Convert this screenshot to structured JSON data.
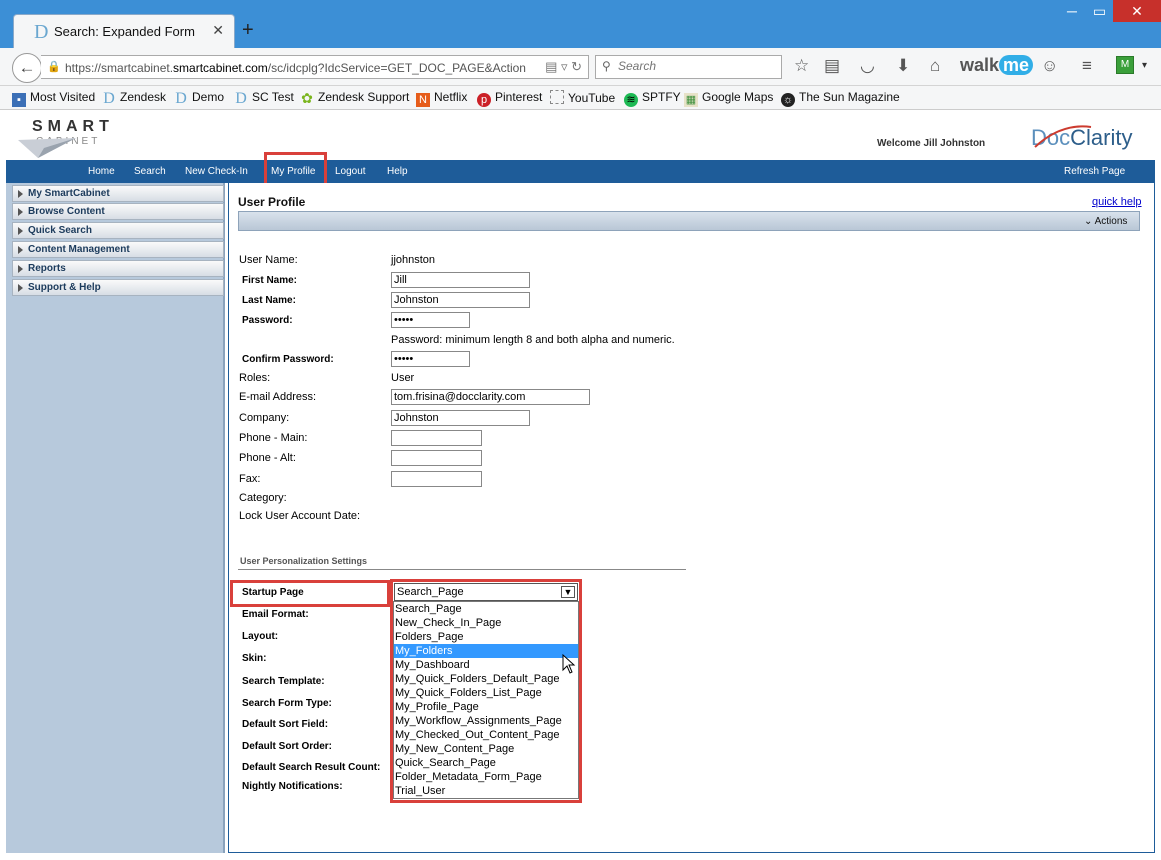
{
  "browser": {
    "tab_title": "Search: Expanded Form",
    "tab_favicon": "D",
    "url_host_prefix": "https://smartcabinet.",
    "url_host": "smartcabinet.com",
    "url_path": "/sc/idcplg?IdcService=GET_DOC_PAGE&Action",
    "search_placeholder": "Search",
    "walkme_a": "walk",
    "walkme_b": "me"
  },
  "bookmarks": [
    {
      "label": "Most Visited",
      "icon": "bookmark-folder-icon"
    },
    {
      "label": "Zendesk",
      "icon": "docclarity-d-icon"
    },
    {
      "label": "Demo",
      "icon": "docclarity-d-icon"
    },
    {
      "label": "SC Test",
      "icon": "docclarity-d-icon"
    },
    {
      "label": "Zendesk Support",
      "icon": "zendesk-icon"
    },
    {
      "label": "Netflix",
      "icon": "netflix-icon"
    },
    {
      "label": "Pinterest",
      "icon": "pinterest-icon"
    },
    {
      "label": "YouTube",
      "icon": "youtube-icon"
    },
    {
      "label": "SPTFY",
      "icon": "spotify-icon"
    },
    {
      "label": "Google Maps",
      "icon": "maps-icon"
    },
    {
      "label": "The Sun Magazine",
      "icon": "sun-icon"
    }
  ],
  "header": {
    "logo_line1": "SMART",
    "logo_line2": "CABINET",
    "welcome": "Welcome Jill Johnston",
    "brand_a": "Doc",
    "brand_b": "Clarity"
  },
  "menu": {
    "home": "Home",
    "search": "Search",
    "new_checkin": "New Check-In",
    "my_profile": "My Profile",
    "logout": "Logout",
    "help": "Help",
    "refresh": "Refresh Page"
  },
  "sidebar": {
    "items": [
      "My SmartCabinet",
      "Browse Content",
      "Quick Search",
      "Content Management",
      "Reports",
      "Support & Help"
    ]
  },
  "page": {
    "title": "User Profile",
    "quick_help": "quick help",
    "actions": "Actions"
  },
  "profile": {
    "user_name_label": "User Name:",
    "user_name": "jjohnston",
    "first_name_label": "First Name:",
    "first_name": "Jill",
    "last_name_label": "Last Name:",
    "last_name": "Johnston",
    "password_label": "Password:",
    "password": "•••••",
    "password_hint": "Password: minimum length 8 and both alpha and numeric.",
    "confirm_label": "Confirm Password:",
    "confirm": "•••••",
    "roles_label": "Roles:",
    "roles": "User",
    "email_label": "E-mail Address:",
    "email": "tom.frisina@docclarity.com",
    "company_label": "Company:",
    "company": "Johnston",
    "phone_main_label": "Phone - Main:",
    "phone_alt_label": "Phone - Alt:",
    "fax_label": "Fax:",
    "category_label": "Category:",
    "lock_label": "Lock User Account Date:"
  },
  "personalization": {
    "section_title": "User Personalization Settings",
    "startup_label": "Startup Page",
    "email_format_label": "Email Format:",
    "layout_label": "Layout:",
    "skin_label": "Skin:",
    "search_template_label": "Search Template:",
    "search_form_type_label": "Search Form Type:",
    "default_sort_field_label": "Default Sort Field:",
    "default_sort_order_label": "Default Sort Order:",
    "default_result_count_label": "Default Search Result Count:",
    "nightly_label": "Nightly Notifications:",
    "startup_value": "Search_Page",
    "startup_options": [
      "Search_Page",
      "New_Check_In_Page",
      "Folders_Page",
      "My_Folders",
      "My_Dashboard",
      "My_Quick_Folders_Default_Page",
      "My_Quick_Folders_List_Page",
      "My_Profile_Page",
      "My_Workflow_Assignments_Page",
      "My_Checked_Out_Content_Page",
      "My_New_Content_Page",
      "Quick_Search_Page",
      "Folder_Metadata_Form_Page",
      "Trial_User"
    ],
    "highlighted_option": "My_Folders"
  },
  "colors": {
    "menu_bar": "#1e5c99",
    "titlebar": "#3c8fd6",
    "highlight_box": "#d9403b",
    "selected_option": "#3399ff"
  }
}
